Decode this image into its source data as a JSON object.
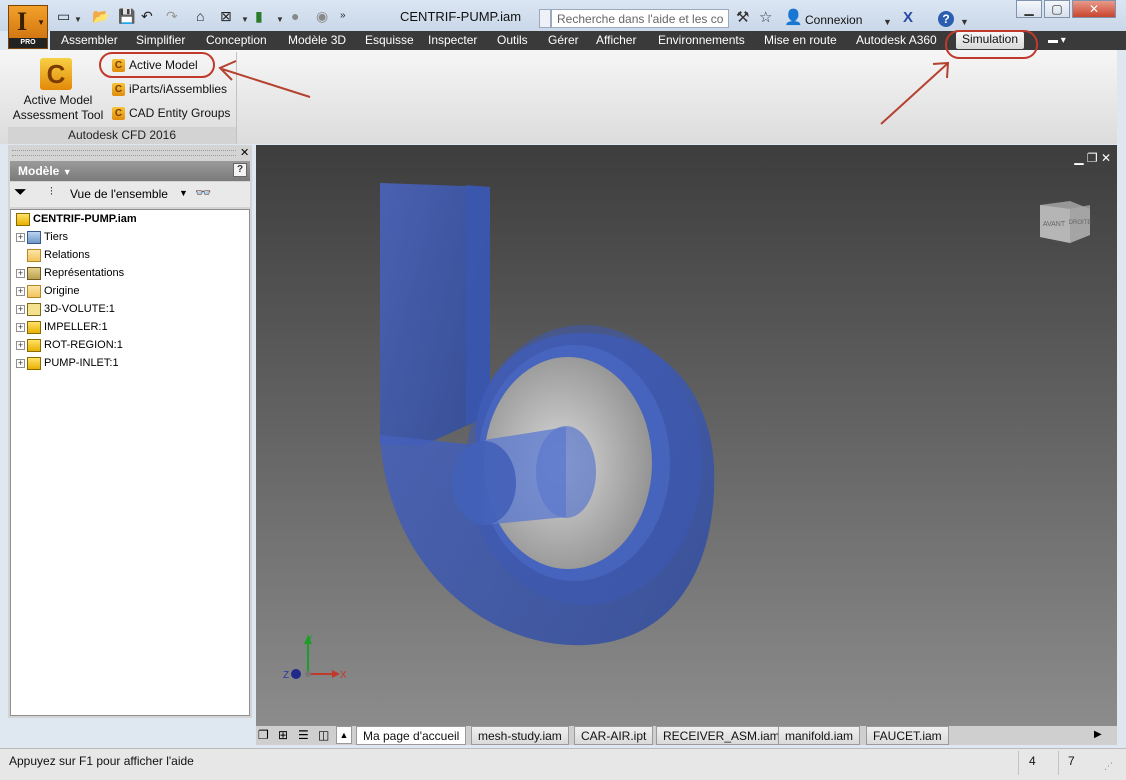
{
  "window": {
    "document_title": "CENTRIF-PUMP.iam",
    "search_placeholder": "Recherche dans l'aide et les com",
    "sign_in": "Connexion",
    "app_badge": "PRO",
    "app_letter": "I"
  },
  "menu_tabs": [
    "Assembler",
    "Simplifier",
    "Conception",
    "Modèle 3D",
    "Esquisse",
    "Inspecter",
    "Outils",
    "Gérer",
    "Afficher",
    "Environnements",
    "Mise en route",
    "Autodesk A360",
    "Simulation"
  ],
  "selected_tab": "Simulation",
  "ribbon": {
    "big_button_label": "Active Model Assessment Tool",
    "items": [
      "Active Model",
      "iParts/iAssemblies",
      "CAD Entity Groups"
    ],
    "panel_name": "Autodesk CFD 2016"
  },
  "browser": {
    "header": "Modèle",
    "view_label": "Vue de l'ensemble",
    "root": "CENTRIF-PUMP.iam",
    "nodes": [
      {
        "label": "Tiers",
        "expandable": true,
        "icon": "tiers-icon"
      },
      {
        "label": "Relations",
        "expandable": false,
        "icon": "folder-icon"
      },
      {
        "label": "Représentations",
        "expandable": true,
        "icon": "representations-icon"
      },
      {
        "label": "Origine",
        "expandable": true,
        "icon": "folder-icon"
      },
      {
        "label": "3D-VOLUTE:1",
        "expandable": true,
        "icon": "volute-part-icon"
      },
      {
        "label": "IMPELLER:1",
        "expandable": true,
        "icon": "part-icon"
      },
      {
        "label": "ROT-REGION:1",
        "expandable": true,
        "icon": "part-icon"
      },
      {
        "label": "PUMP-INLET:1",
        "expandable": true,
        "icon": "part-icon"
      }
    ]
  },
  "viewcube": {
    "front": "AVANT",
    "right": "DROITE"
  },
  "triad": {
    "x": "X",
    "y": "Y",
    "z": "Z"
  },
  "doc_tabs": [
    "Ma page d'accueil",
    "mesh-study.iam",
    "CAR-AIR.ipt",
    "RECEIVER_ASM.iam",
    "manifold.iam",
    "FAUCET.iam"
  ],
  "status": {
    "text": "Appuyez sur F1 pour afficher l'aide",
    "n1": "4",
    "n2": "7"
  },
  "colors": {
    "accent_annotation": "#c0392b",
    "model_blue": "#3f5fb0",
    "tab_bar": "#3a3a3a"
  }
}
